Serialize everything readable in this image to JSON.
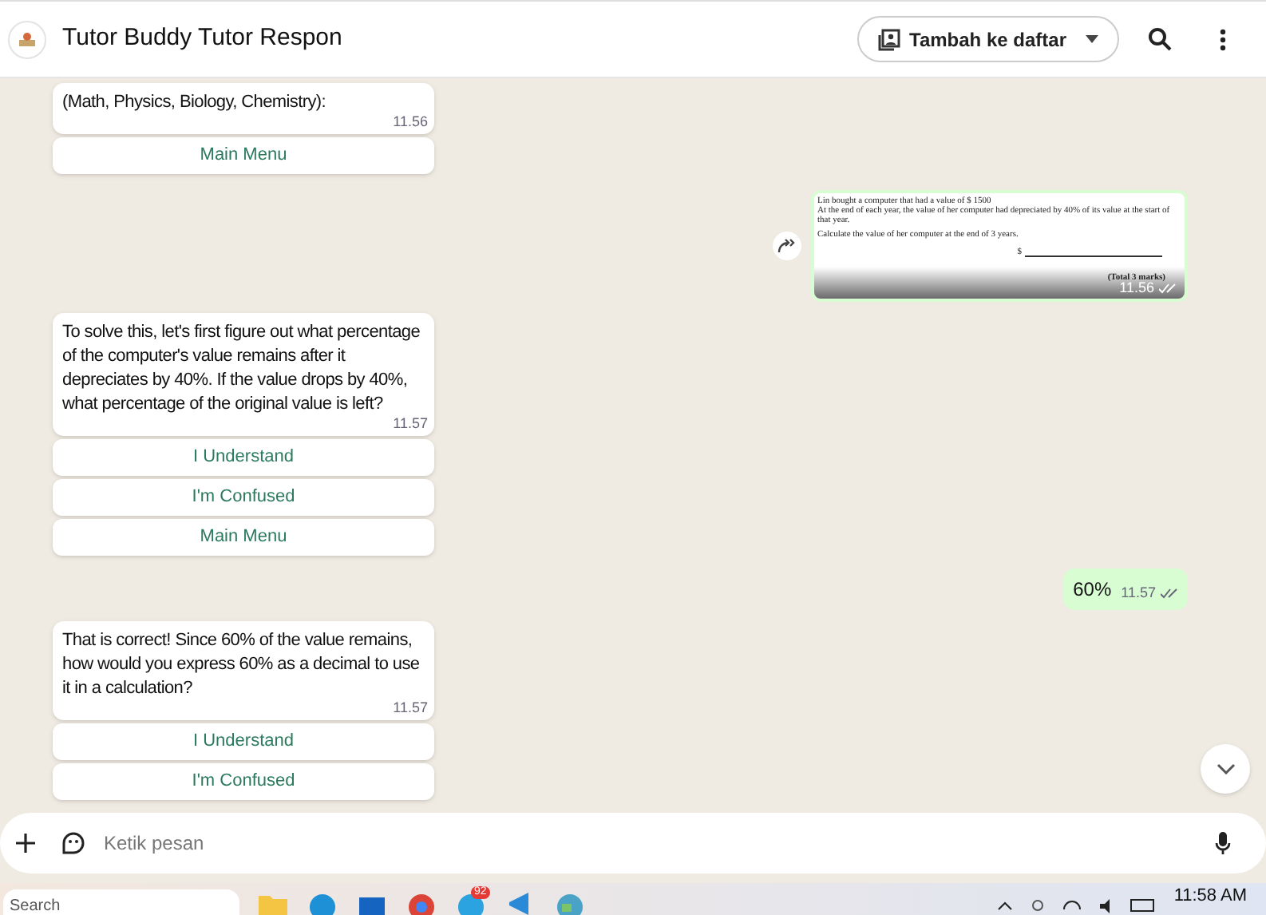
{
  "header": {
    "title": "Tutor Buddy Tutor Respon",
    "add_button": "Tambah ke daftar"
  },
  "messages": [
    {
      "kind": "incoming",
      "text": "(Math, Physics, Biology, Chemistry):",
      "time": "11.56",
      "buttons": [
        "Main Menu"
      ]
    },
    {
      "kind": "image",
      "time": "11.56",
      "read": true,
      "doc": {
        "lines": [
          "Lin bought a computer that had a value of $ 1500",
          "At the end of each year, the value of her computer had depreciated by 40% of its value at the start of that year.",
          "Calculate the value of her computer at the end of 3 years."
        ],
        "answer": "$",
        "marks": "(Total 3 marks)"
      }
    },
    {
      "kind": "incoming",
      "text": "To solve this, let's first figure out what percentage of the computer's value remains after it depreciates by 40%. If the value drops by 40%, what percentage of the original value is left?",
      "time": "11.57",
      "buttons": [
        "I Understand",
        "I'm Confused",
        "Main Menu"
      ]
    },
    {
      "kind": "outgoing",
      "text": "60%",
      "time": "11.57",
      "read": true
    },
    {
      "kind": "incoming",
      "text": "That is correct! Since 60% of the value remains, how would you express 60% as a decimal to use it in a calculation?",
      "time": "11.57",
      "buttons": [
        "I Understand",
        "I'm Confused"
      ]
    }
  ],
  "composer": {
    "placeholder": "Ketik pesan"
  },
  "taskbar": {
    "search": "Search",
    "badge": "92",
    "clock": "11:58 AM"
  }
}
